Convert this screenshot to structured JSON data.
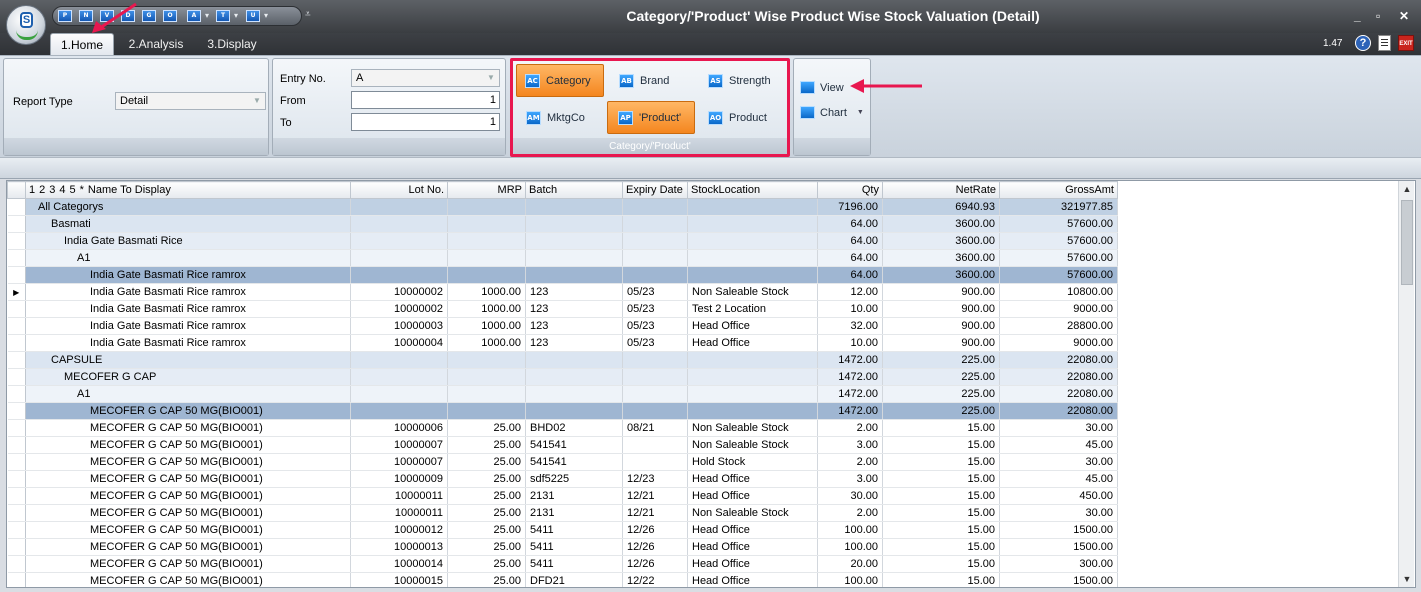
{
  "window": {
    "title": "Category/'Product' Wise Product Wise Stock Valuation (Detail)",
    "version": "1.47",
    "min_glyph": "_",
    "restore_glyph": "▫",
    "close_glyph": "✕",
    "help_glyph": "?",
    "exit_label": "EXIT"
  },
  "qat": {
    "buttons": [
      "P",
      "N",
      "V",
      "D",
      "G",
      "O",
      "A",
      "T",
      "U"
    ],
    "more_glyph": "⩡"
  },
  "tabs": [
    {
      "label": "1.Home",
      "active": true
    },
    {
      "label": "2.Analysis",
      "active": false
    },
    {
      "label": "3.Display",
      "active": false
    }
  ],
  "ribbon": {
    "report_type_label": "Report Type",
    "report_type_value": "Detail",
    "entry_no_label": "Entry No.",
    "entry_no_value": "A",
    "from_label": "From",
    "from_value": "1",
    "to_label": "To",
    "to_value": "1",
    "group_title": "Category/'Product'",
    "buttons": {
      "category": "Category",
      "brand": "Brand",
      "strength": "Strength",
      "mktgco": "MktgCo",
      "product_q": "'Product'",
      "product": "Product"
    },
    "view_label": "View",
    "chart_label": "Chart"
  },
  "grid": {
    "level_tabs": [
      "1",
      "2",
      "3",
      "4",
      "5",
      "*"
    ],
    "columns": [
      "Name To Display",
      "Lot No.",
      "MRP",
      "Batch",
      "Expiry Date",
      "StockLocation",
      "Qty",
      "NetRate",
      "GrossAmt"
    ],
    "rows": [
      {
        "level": 0,
        "cells": [
          "All Categorys",
          "",
          "",
          "",
          "",
          "",
          "7196.00",
          "6940.93",
          "321977.85"
        ]
      },
      {
        "level": 1,
        "cells": [
          "Basmati",
          "",
          "",
          "",
          "",
          "",
          "64.00",
          "3600.00",
          "57600.00"
        ]
      },
      {
        "level": 2,
        "cells": [
          "India Gate Basmati Rice",
          "",
          "",
          "",
          "",
          "",
          "64.00",
          "3600.00",
          "57600.00"
        ]
      },
      {
        "level": 3,
        "cells": [
          "A1",
          "",
          "",
          "",
          "",
          "",
          "64.00",
          "3600.00",
          "57600.00"
        ]
      },
      {
        "level": 4,
        "cells": [
          "India Gate Basmati Rice ramrox",
          "",
          "",
          "",
          "",
          "",
          "64.00",
          "3600.00",
          "57600.00"
        ]
      },
      {
        "level": 5,
        "current": true,
        "cells": [
          "India Gate Basmati Rice ramrox",
          "10000002",
          "1000.00",
          "123",
          "05/23",
          "Non Saleable Stock",
          "12.00",
          "900.00",
          "10800.00"
        ]
      },
      {
        "level": 5,
        "cells": [
          "India Gate Basmati Rice ramrox",
          "10000002",
          "1000.00",
          "123",
          "05/23",
          "Test 2 Location",
          "10.00",
          "900.00",
          "9000.00"
        ]
      },
      {
        "level": 5,
        "cells": [
          "India Gate Basmati Rice ramrox",
          "10000003",
          "1000.00",
          "123",
          "05/23",
          "Head Office",
          "32.00",
          "900.00",
          "28800.00"
        ]
      },
      {
        "level": 5,
        "cells": [
          "India Gate Basmati Rice ramrox",
          "10000004",
          "1000.00",
          "123",
          "05/23",
          "Head Office",
          "10.00",
          "900.00",
          "9000.00"
        ]
      },
      {
        "level": 1,
        "cells": [
          "CAPSULE",
          "",
          "",
          "",
          "",
          "",
          "1472.00",
          "225.00",
          "22080.00"
        ]
      },
      {
        "level": 2,
        "cells": [
          "MECOFER G CAP",
          "",
          "",
          "",
          "",
          "",
          "1472.00",
          "225.00",
          "22080.00"
        ]
      },
      {
        "level": 3,
        "cells": [
          "A1",
          "",
          "",
          "",
          "",
          "",
          "1472.00",
          "225.00",
          "22080.00"
        ]
      },
      {
        "level": 4,
        "cells": [
          "MECOFER G CAP 50 MG(BIO001)",
          "",
          "",
          "",
          "",
          "",
          "1472.00",
          "225.00",
          "22080.00"
        ]
      },
      {
        "level": 5,
        "cells": [
          "MECOFER G CAP 50 MG(BIO001)",
          "10000006",
          "25.00",
          "BHD02",
          "08/21",
          "Non Saleable Stock",
          "2.00",
          "15.00",
          "30.00"
        ]
      },
      {
        "level": 5,
        "cells": [
          "MECOFER G CAP 50 MG(BIO001)",
          "10000007",
          "25.00",
          "541541",
          "",
          "Non Saleable Stock",
          "3.00",
          "15.00",
          "45.00"
        ]
      },
      {
        "level": 5,
        "cells": [
          "MECOFER G CAP 50 MG(BIO001)",
          "10000007",
          "25.00",
          "541541",
          "",
          "Hold Stock",
          "2.00",
          "15.00",
          "30.00"
        ]
      },
      {
        "level": 5,
        "cells": [
          "MECOFER G CAP 50 MG(BIO001)",
          "10000009",
          "25.00",
          "sdf5225",
          "12/23",
          "Head Office",
          "3.00",
          "15.00",
          "45.00"
        ]
      },
      {
        "level": 5,
        "cells": [
          "MECOFER G CAP 50 MG(BIO001)",
          "10000011",
          "25.00",
          "2131",
          "12/21",
          "Head Office",
          "30.00",
          "15.00",
          "450.00"
        ]
      },
      {
        "level": 5,
        "cells": [
          "MECOFER G CAP 50 MG(BIO001)",
          "10000011",
          "25.00",
          "2131",
          "12/21",
          "Non Saleable Stock",
          "2.00",
          "15.00",
          "30.00"
        ]
      },
      {
        "level": 5,
        "cells": [
          "MECOFER G CAP 50 MG(BIO001)",
          "10000012",
          "25.00",
          "5411",
          "12/26",
          "Head Office",
          "100.00",
          "15.00",
          "1500.00"
        ]
      },
      {
        "level": 5,
        "cells": [
          "MECOFER G CAP 50 MG(BIO001)",
          "10000013",
          "25.00",
          "5411",
          "12/26",
          "Head Office",
          "100.00",
          "15.00",
          "1500.00"
        ]
      },
      {
        "level": 5,
        "cells": [
          "MECOFER G CAP 50 MG(BIO001)",
          "10000014",
          "25.00",
          "5411",
          "12/26",
          "Head Office",
          "20.00",
          "15.00",
          "300.00"
        ]
      },
      {
        "level": 5,
        "cells": [
          "MECOFER G CAP 50 MG(BIO001)",
          "10000015",
          "25.00",
          "DFD21",
          "12/22",
          "Head Office",
          "100.00",
          "15.00",
          "1500.00"
        ]
      }
    ]
  },
  "scrollbar": {
    "up_glyph": "▲",
    "down_glyph": "▼"
  },
  "colors": {
    "accent_orange": "#f4861f",
    "highlight_red": "#e8174f"
  }
}
